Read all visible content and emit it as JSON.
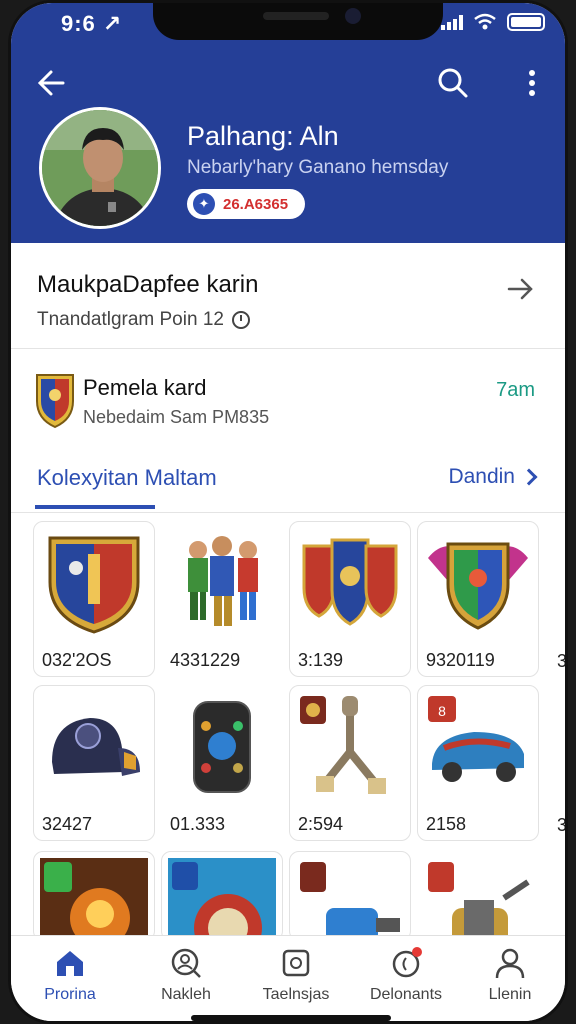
{
  "status_bar": {
    "time": "9:6 ↗"
  },
  "header": {
    "profile_name": "Palhang: Aln",
    "profile_subtitle": "Nebarly'hary Ganano hemsday",
    "points_value": "26.A6365"
  },
  "rows": {
    "row1_title": "MaukpaDapfee karin",
    "row1_subtitle": "Tnandatlgram Poin 12",
    "row2_title": "Pemela kard",
    "row2_subtitle": "Nebedaim Sam PM835",
    "row2_time": "7am"
  },
  "tabs": {
    "collection_label": "Kolexyitan Maltam",
    "link_label": "Dandin"
  },
  "items": [
    {
      "number": "032'2OS",
      "icon": "crest-shield-icon"
    },
    {
      "number": "4331229",
      "icon": "action-figures-icon"
    },
    {
      "number": "3:139",
      "icon": "tri-shield-icon"
    },
    {
      "number": "9320119",
      "icon": "winged-crest-icon"
    },
    {
      "number": "32427",
      "icon": "vr-headset-icon"
    },
    {
      "number": "01.333",
      "icon": "gadget-device-icon"
    },
    {
      "number": "2:594",
      "icon": "pull-cord-icon"
    },
    {
      "number": "2158",
      "icon": "toy-car-icon"
    },
    {
      "number": "",
      "icon": "warrior-card-icon"
    },
    {
      "number": "",
      "icon": "badge-card-icon"
    },
    {
      "number": "",
      "icon": "blue-tool-icon"
    },
    {
      "number": "",
      "icon": "cylinder-part-icon"
    }
  ],
  "edge_numbers": [
    "3",
    "3"
  ],
  "nav": [
    {
      "label": "Prorina",
      "icon": "home-icon"
    },
    {
      "label": "Nakleh",
      "icon": "search-user-icon"
    },
    {
      "label": "Taelnsjas",
      "icon": "square-icon"
    },
    {
      "label": "Delonants",
      "icon": "notification-icon"
    },
    {
      "label": "Llenin",
      "icon": "person-icon"
    }
  ],
  "colors": {
    "primary": "#253f97",
    "accent_blue": "#2d4fb3",
    "time_green": "#1b9a84",
    "badge_red": "#d32f2f"
  }
}
